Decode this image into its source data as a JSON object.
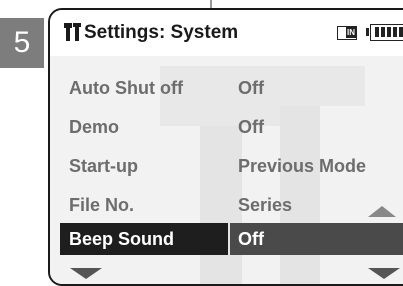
{
  "step_number": "5",
  "header": {
    "title": "Settings: System",
    "mode_badge": "IN",
    "icons": [
      "tools-icon",
      "memory-mode-icon",
      "battery-icon"
    ]
  },
  "menu": {
    "items": [
      {
        "label": "Auto Shut off",
        "value": "Off"
      },
      {
        "label": "Demo",
        "value": "Off"
      },
      {
        "label": "Start-up",
        "value": "Previous Mode"
      },
      {
        "label": "File No.",
        "value": "Series"
      },
      {
        "label": "Beep Sound",
        "value": "Off",
        "selected": true
      }
    ],
    "scroll_icons": [
      "up-arrow-icon",
      "down-arrow-icon"
    ]
  },
  "colors": {
    "selected_label_bg": "#1e1e1e",
    "selected_value_bg": "#4a4a4a",
    "text": "#6d6d6d",
    "step_box": "#7d7d7d"
  }
}
